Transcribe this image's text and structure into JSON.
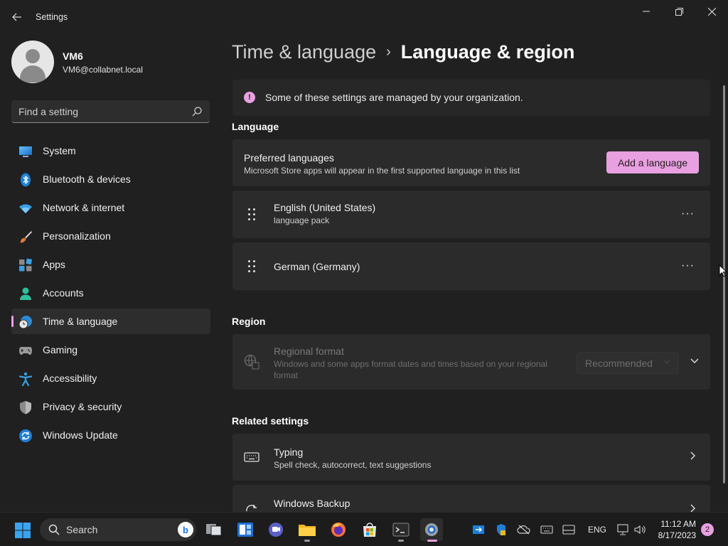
{
  "window": {
    "title": "Settings",
    "back_icon": "back-arrow-icon",
    "minimize_icon": "minimize-icon",
    "restore_icon": "restore-icon",
    "close_icon": "close-icon"
  },
  "profile": {
    "name": "VM6",
    "email": "VM6@collabnet.local"
  },
  "search": {
    "placeholder": "Find a setting",
    "icon": "search-icon"
  },
  "sidebar": {
    "items": [
      {
        "label": "System",
        "icon": "system-icon"
      },
      {
        "label": "Bluetooth & devices",
        "icon": "bluetooth-icon"
      },
      {
        "label": "Network & internet",
        "icon": "wifi-icon"
      },
      {
        "label": "Personalization",
        "icon": "brush-icon"
      },
      {
        "label": "Apps",
        "icon": "apps-icon"
      },
      {
        "label": "Accounts",
        "icon": "accounts-icon"
      },
      {
        "label": "Time & language",
        "icon": "globe-clock-icon",
        "active": true
      },
      {
        "label": "Gaming",
        "icon": "gamepad-icon"
      },
      {
        "label": "Accessibility",
        "icon": "accessibility-icon"
      },
      {
        "label": "Privacy & security",
        "icon": "shield-icon"
      },
      {
        "label": "Windows Update",
        "icon": "update-icon"
      }
    ]
  },
  "breadcrumb": {
    "parent": "Time & language",
    "separator": "›",
    "current": "Language & region"
  },
  "notice": {
    "text": "Some of these settings are managed by your organization.",
    "icon": "info-icon"
  },
  "language": {
    "section_title": "Language",
    "preferred_title": "Preferred languages",
    "preferred_subtitle": "Microsoft Store apps will appear in the first supported language in this list",
    "add_button": "Add a language",
    "items": [
      {
        "name": "English (United States)",
        "detail": "language pack"
      },
      {
        "name": "German (Germany)",
        "detail": ""
      }
    ],
    "more_label": "···"
  },
  "region": {
    "section_title": "Region",
    "format_title": "Regional format",
    "format_subtitle": "Windows and some apps format dates and times based on your regional format",
    "format_value": "Recommended"
  },
  "related": {
    "section_title": "Related settings",
    "items": [
      {
        "title": "Typing",
        "subtitle": "Spell check, autocorrect, text suggestions",
        "icon": "keyboard-icon"
      },
      {
        "title": "Windows Backup",
        "subtitle": "",
        "icon": "backup-icon"
      }
    ]
  },
  "taskbar": {
    "search_label": "Search",
    "language": "ENG",
    "time": "11:12 AM",
    "date": "8/17/2023",
    "notification_count": "2"
  },
  "colors": {
    "accent": "#e9a0e0",
    "background": "#202020",
    "card": "#2b2b2b"
  }
}
